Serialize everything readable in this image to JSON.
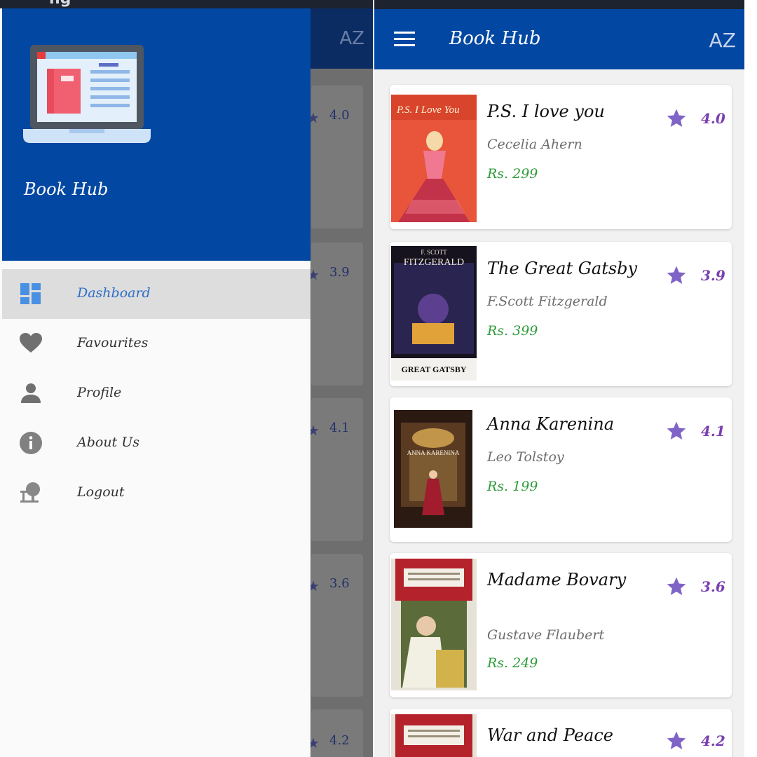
{
  "status_fragment": "ng",
  "background": {
    "az_label": "AZ",
    "ratings": [
      "4.0",
      "3.9",
      "4.1",
      "3.6",
      "4.2"
    ]
  },
  "drawer": {
    "title": "Book Hub",
    "menu": [
      {
        "label": "Dashboard",
        "icon": "dashboard-icon",
        "active": true
      },
      {
        "label": "Favourites",
        "icon": "heart-icon",
        "active": false
      },
      {
        "label": "Profile",
        "icon": "person-icon",
        "active": false
      },
      {
        "label": "About Us",
        "icon": "info-icon",
        "active": false
      },
      {
        "label": "Logout",
        "icon": "logout-icon",
        "active": false
      }
    ]
  },
  "app": {
    "title": "Book Hub",
    "az_label": "AZ"
  },
  "books": [
    {
      "title": "P.S. I love you",
      "author": "Cecelia Ahern",
      "price": "Rs. 299",
      "rating": "4.0"
    },
    {
      "title": "The Great Gatsby",
      "author": "F.Scott Fitzgerald",
      "price": "Rs. 399",
      "rating": "3.9"
    },
    {
      "title": "Anna Karenina",
      "author": "Leo Tolstoy",
      "price": "Rs. 199",
      "rating": "4.1"
    },
    {
      "title": "Madame Bovary",
      "author": "Gustave Flaubert",
      "price": "Rs. 249",
      "rating": "3.6"
    },
    {
      "title": "War and Peace",
      "author": "",
      "price": "",
      "rating": "4.2"
    }
  ],
  "covers": {
    "ps_title": "P.S. I Love You",
    "gatsby_author": "F. SCOTT",
    "gatsby_name": "FITZGERALD",
    "gatsby_title": "GREAT GATSBY",
    "anna_title": "ANNA KARENINA"
  },
  "colors": {
    "primary": "#0247a2",
    "price": "#2e9b39",
    "rating": "#7b3fb0",
    "star": "#7f63c7"
  }
}
